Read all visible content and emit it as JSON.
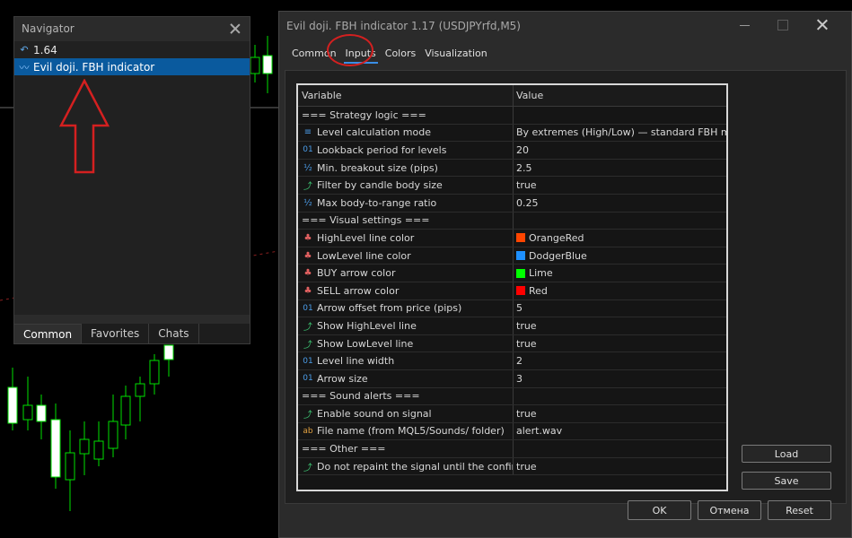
{
  "navigator": {
    "title": "Navigator",
    "items": [
      {
        "label": "1.64",
        "icon": "version-icon"
      },
      {
        "label": "Evil doji. FBH indicator",
        "icon": "indicator-icon",
        "selected": true
      }
    ],
    "tabs": [
      "Common",
      "Favorites",
      "Chats"
    ],
    "active_tab": "Common"
  },
  "dialog": {
    "title": "Evil doji. FBH indicator 1.17 (USDJPYrfd,M5)",
    "tabs": [
      "Common",
      "Inputs",
      "Colors",
      "Visualization"
    ],
    "active_tab": "Inputs",
    "columns": [
      "Variable",
      "Value"
    ],
    "rows": [
      {
        "type": "section",
        "variable": "=== Strategy logic ===",
        "value": ""
      },
      {
        "type": "enum",
        "icon": "enum-icon",
        "variable": "Level calculation mode",
        "value": "By extremes (High/Low) — standard FBH mode"
      },
      {
        "type": "int",
        "icon": "integer-icon",
        "variable": "Lookback period for levels",
        "value": "20"
      },
      {
        "type": "double",
        "icon": "double-icon",
        "variable": "Min. breakout size (pips)",
        "value": "2.5"
      },
      {
        "type": "bool",
        "icon": "bool-icon",
        "variable": "Filter by candle body size",
        "value": "true"
      },
      {
        "type": "double",
        "icon": "double-icon",
        "variable": "Max body-to-range ratio",
        "value": "0.25"
      },
      {
        "type": "section",
        "variable": "=== Visual settings ===",
        "value": ""
      },
      {
        "type": "color",
        "icon": "color-icon",
        "variable": "HighLevel line color",
        "value": "OrangeRed",
        "swatch": "#ff4500"
      },
      {
        "type": "color",
        "icon": "color-icon",
        "variable": "LowLevel line color",
        "value": "DodgerBlue",
        "swatch": "#1e90ff"
      },
      {
        "type": "color",
        "icon": "color-icon",
        "variable": "BUY arrow color",
        "value": "Lime",
        "swatch": "#00ff00"
      },
      {
        "type": "color",
        "icon": "color-icon",
        "variable": "SELL arrow color",
        "value": "Red",
        "swatch": "#ff0000"
      },
      {
        "type": "int",
        "icon": "integer-icon",
        "variable": "Arrow offset from price (pips)",
        "value": "5"
      },
      {
        "type": "bool",
        "icon": "bool-icon",
        "variable": "Show HighLevel line",
        "value": "true"
      },
      {
        "type": "bool",
        "icon": "bool-icon",
        "variable": "Show LowLevel line",
        "value": "true"
      },
      {
        "type": "int",
        "icon": "integer-icon",
        "variable": "Level line width",
        "value": "2"
      },
      {
        "type": "int",
        "icon": "integer-icon",
        "variable": "Arrow size",
        "value": "3"
      },
      {
        "type": "section",
        "variable": "=== Sound alerts ===",
        "value": ""
      },
      {
        "type": "bool",
        "icon": "bool-icon",
        "variable": "Enable sound on signal",
        "value": "true"
      },
      {
        "type": "string",
        "icon": "string-icon",
        "variable": "File name (from MQL5/Sounds/ folder)",
        "value": "alert.wav"
      },
      {
        "type": "section",
        "variable": "=== Other ===",
        "value": ""
      },
      {
        "type": "bool",
        "icon": "bool-icon",
        "variable": "Do not repaint the signal until the confirma...",
        "value": "true"
      }
    ],
    "side_buttons": {
      "load": "Load",
      "save": "Save"
    },
    "bottom_buttons": {
      "ok": "OK",
      "cancel": "Отмена",
      "reset": "Reset"
    }
  },
  "colors": {
    "accent": "#0a5a9e",
    "tab_underline": "#3a8ee6",
    "annotation": "#d42020",
    "bull_candle": "#00ff00"
  }
}
